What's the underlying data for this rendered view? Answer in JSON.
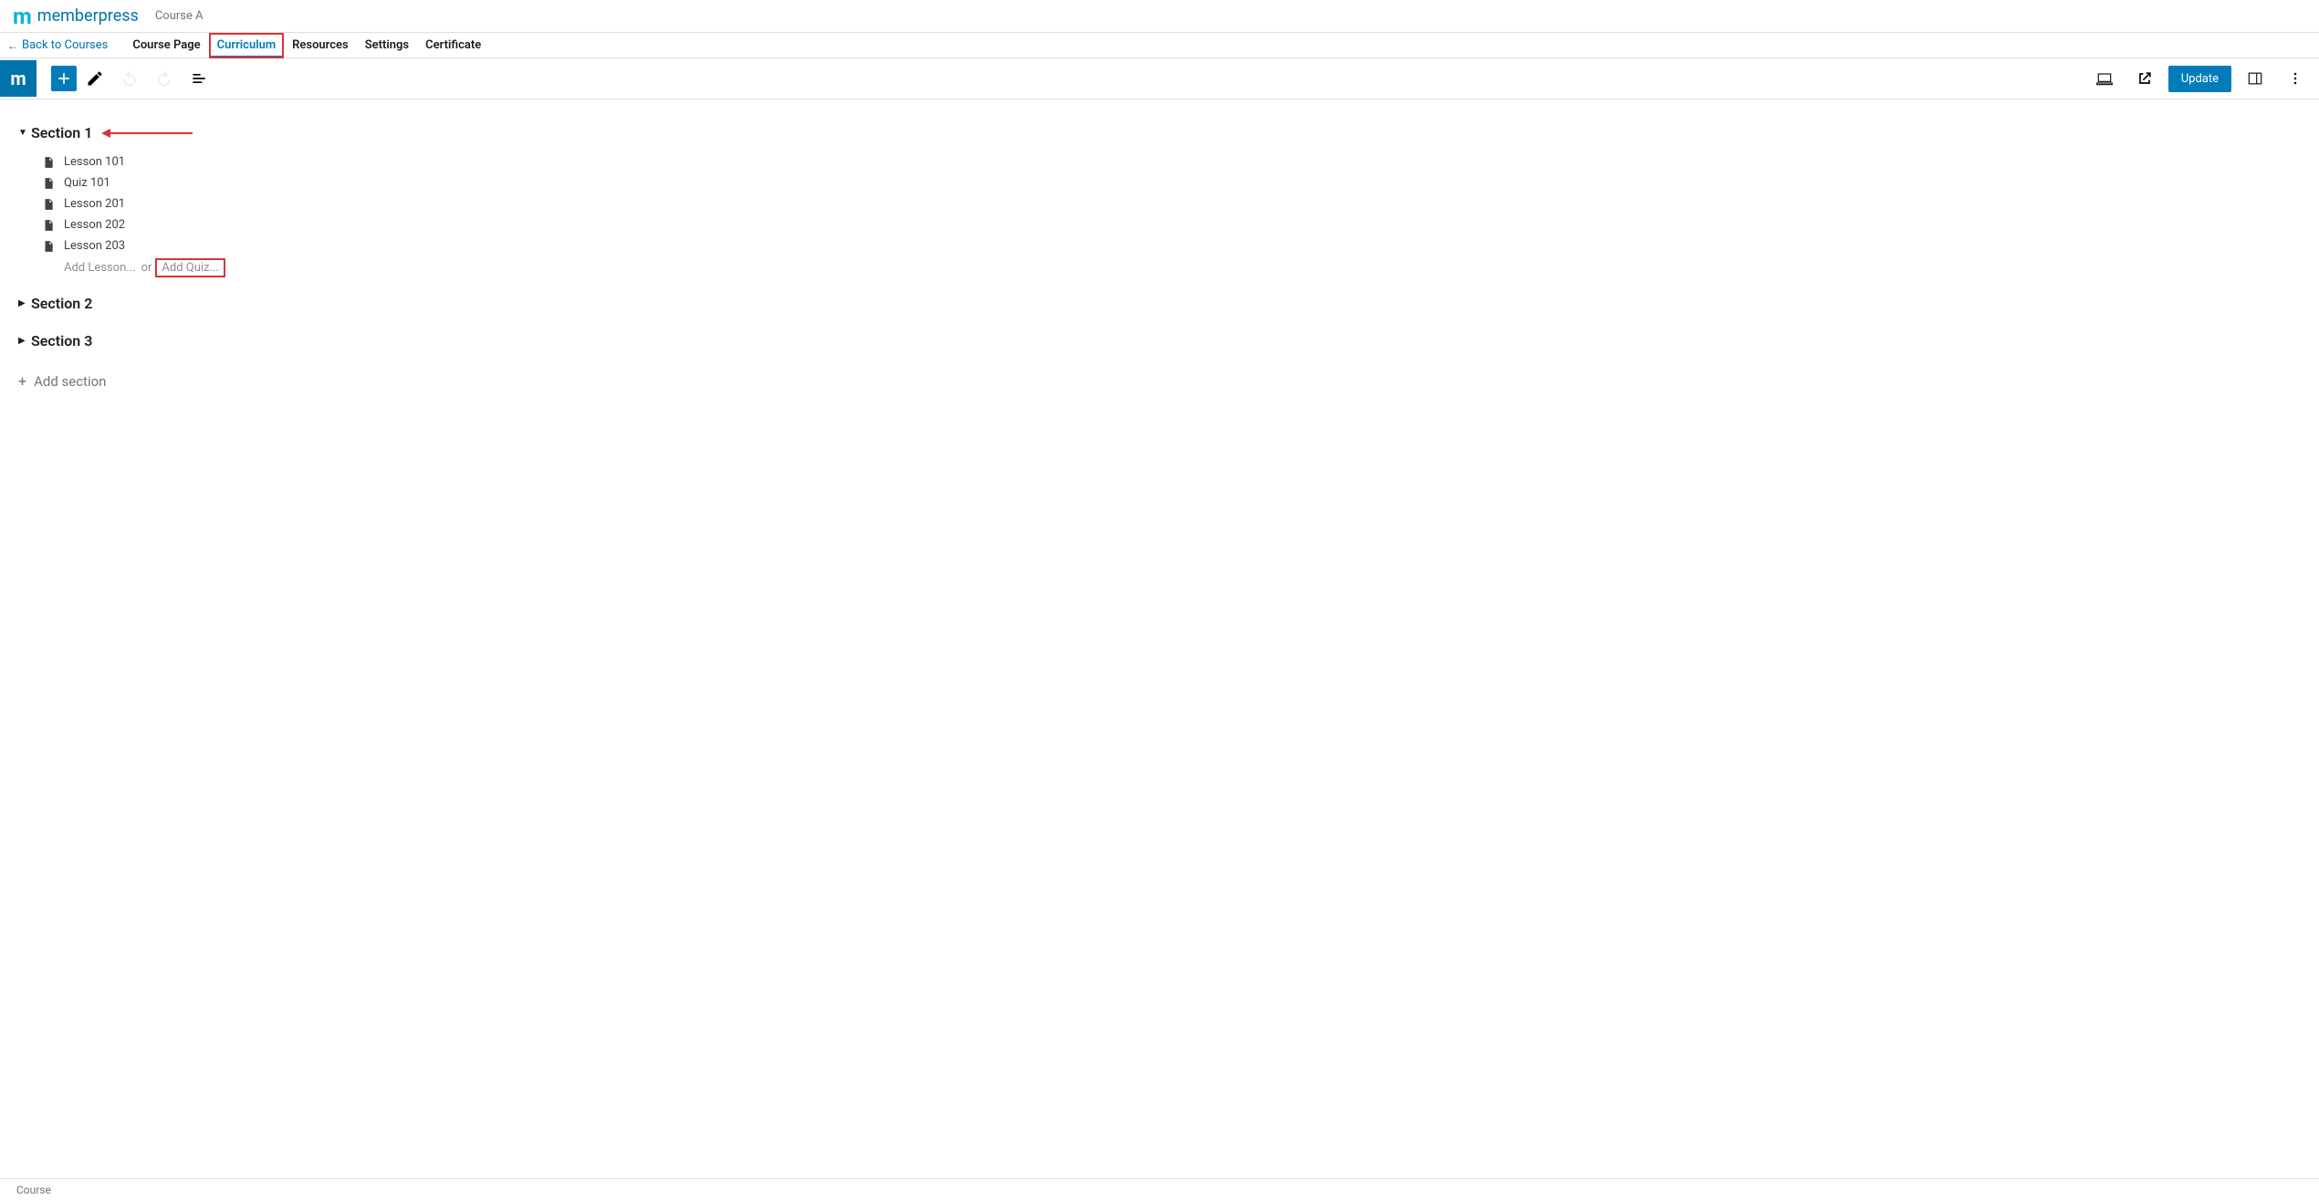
{
  "header": {
    "brand": "memberpress",
    "course_name": "Course A"
  },
  "subnav": {
    "back_label": "Back to Courses",
    "tabs": [
      {
        "label": "Course Page"
      },
      {
        "label": "Curriculum"
      },
      {
        "label": "Resources"
      },
      {
        "label": "Settings"
      },
      {
        "label": "Certificate"
      }
    ]
  },
  "toolbar": {
    "update_label": "Update"
  },
  "curriculum": {
    "sections": [
      {
        "title": "Section 1",
        "expanded": true,
        "items": [
          {
            "type": "lesson",
            "label": "Lesson 101"
          },
          {
            "type": "quiz",
            "label": "Quiz 101"
          },
          {
            "type": "lesson",
            "label": "Lesson 201"
          },
          {
            "type": "lesson",
            "label": "Lesson 202"
          },
          {
            "type": "lesson",
            "label": "Lesson 203"
          }
        ],
        "add_lesson_label": "Add Lesson...",
        "add_or_label": "or",
        "add_quiz_label": "Add Quiz..."
      },
      {
        "title": "Section 2",
        "expanded": false
      },
      {
        "title": "Section 3",
        "expanded": false
      }
    ],
    "add_section_label": "Add section"
  },
  "footer": {
    "breadcrumb": "Course"
  }
}
